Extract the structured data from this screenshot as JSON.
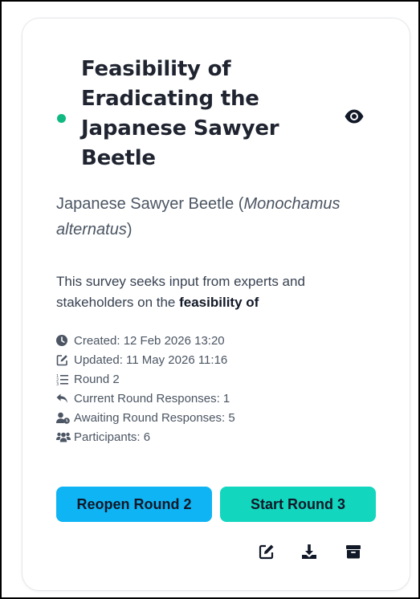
{
  "card": {
    "status_color": "#10b981",
    "title": "Feasibility of Eradicating the Japanese Sawyer Beetle",
    "subtitle_plain": "Japanese Sawyer Beetle (",
    "subtitle_italic": "Monochamus alternatus",
    "subtitle_close": ")",
    "description_plain": "This survey seeks input from experts and stakeholders on the ",
    "description_bold": "feasibility of",
    "meta": {
      "created": "Created: 12 Feb 2026 13:20",
      "updated": "Updated: 11 May 2026 11:16",
      "round": "Round 2",
      "current_responses": "Current Round Responses: 1",
      "awaiting_responses": "Awaiting Round Responses: 5",
      "participants": "Participants: 6"
    },
    "buttons": {
      "reopen_label": "Reopen Round 2",
      "start_label": "Start Round 3"
    },
    "icons": {
      "visibility": "eye-icon",
      "created": "clock-icon",
      "updated": "edit-icon",
      "round": "numbered-list-icon",
      "current_responses": "reply-icon",
      "awaiting_responses": "user-clock-icon",
      "participants": "users-icon",
      "edit_action": "edit-icon",
      "download_action": "download-icon",
      "archive_action": "archive-icon"
    },
    "colors": {
      "reopen_button": "#0fb4f4",
      "start_button": "#12d6be"
    }
  }
}
